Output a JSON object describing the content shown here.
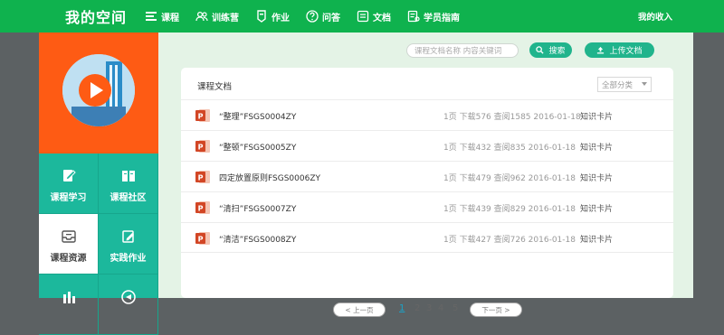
{
  "header": {
    "brand": "我的空间",
    "nav": [
      {
        "label": "课程",
        "icon": "list-icon"
      },
      {
        "label": "训练营",
        "icon": "users-icon"
      },
      {
        "label": "作业",
        "icon": "badge-icon"
      },
      {
        "label": "问答",
        "icon": "question-icon"
      },
      {
        "label": "文档",
        "icon": "document-icon"
      },
      {
        "label": "学员指南",
        "icon": "guide-icon"
      }
    ],
    "income": "我的收入"
  },
  "sidebar": {
    "tiles": [
      {
        "label": "课程学习",
        "icon": "pencil-icon"
      },
      {
        "label": "课程社区",
        "icon": "book-icon"
      },
      {
        "label": "课程资源",
        "icon": "inbox-icon",
        "active": true
      },
      {
        "label": "实践作业",
        "icon": "edit-icon"
      }
    ]
  },
  "toolbar": {
    "search_placeholder": "课程文档名称 内容关键词",
    "search_label": "搜索",
    "upload_label": "上传文档"
  },
  "documents": {
    "title": "课程文档",
    "filter_value": "全部分类",
    "rows": [
      {
        "name": "“整理”FSGS0004ZY",
        "meta": "1页 下载576 查阅1585 2016-01-18",
        "type": "知识卡片"
      },
      {
        "name": "“整顿”FSGS0005ZY",
        "meta": "1页 下载432 查阅835 2016-01-18",
        "type": "知识卡片"
      },
      {
        "name": "四定放置原则FSGS0006ZY",
        "meta": "1页 下载479 查阅962 2016-01-18",
        "type": "知识卡片"
      },
      {
        "name": "“清扫”FSGS0007ZY",
        "meta": "1页 下载439 查阅829 2016-01-18",
        "type": "知识卡片"
      },
      {
        "name": "“清洁”FSGS0008ZY",
        "meta": "1页 下载427 查阅726 2016-01-18",
        "type": "知识卡片"
      }
    ]
  },
  "pagination": {
    "prev_label": "< 上一页",
    "next_label": "下一页 >",
    "pages": [
      "1",
      "2",
      "3",
      "4",
      "5"
    ],
    "current": "1"
  },
  "colors": {
    "brand_green": "#0fb24e",
    "teal": "#1cb89c",
    "orange": "#fe5b14",
    "ppt_red": "#d24625"
  }
}
